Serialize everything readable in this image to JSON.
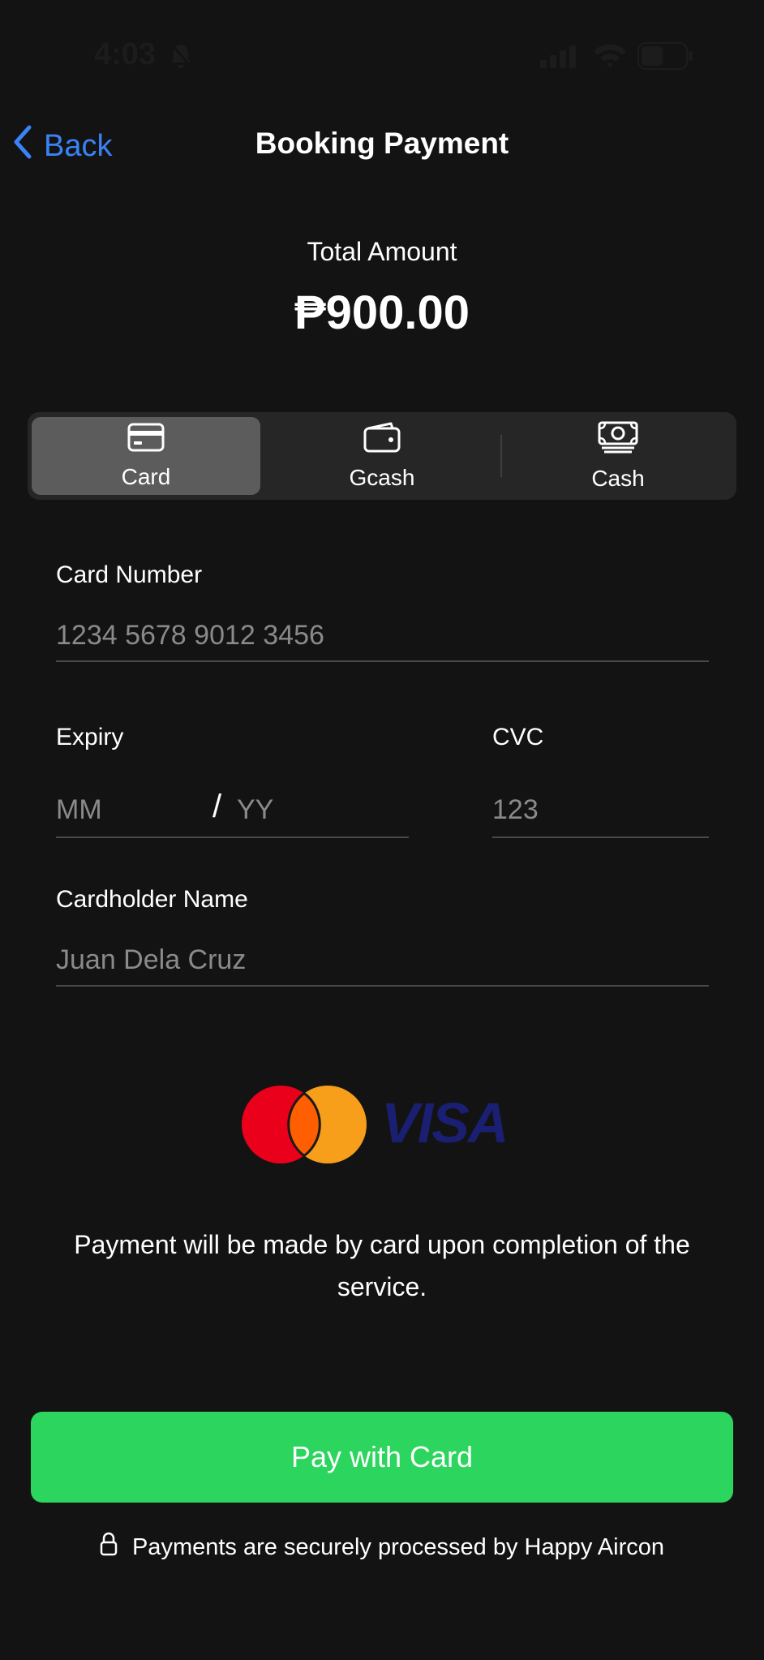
{
  "status_bar": {
    "time": "4:03"
  },
  "nav": {
    "back_label": "Back",
    "title": "Booking Payment"
  },
  "total": {
    "label": "Total Amount",
    "value": "₱900.00"
  },
  "payment_methods": [
    {
      "label": "Card",
      "icon": "credit-card-icon",
      "active": true
    },
    {
      "label": "Gcash",
      "icon": "wallet-icon",
      "active": false
    },
    {
      "label": "Cash",
      "icon": "banknote-icon",
      "active": false
    }
  ],
  "form": {
    "card_number": {
      "label": "Card Number",
      "placeholder": "1234 5678 9012 3456",
      "value": ""
    },
    "expiry": {
      "label": "Expiry",
      "month_placeholder": "MM",
      "separator": "/",
      "year_placeholder": "YY"
    },
    "cvc": {
      "label": "CVC",
      "placeholder": "123"
    },
    "cardholder": {
      "label": "Cardholder Name",
      "placeholder": "Juan Dela Cruz"
    }
  },
  "logos": {
    "visa_text": "VISA"
  },
  "info_text": "Payment will be made by card upon completion of the service.",
  "pay_button_label": "Pay with Card",
  "secure_text": "Payments are securely processed by Happy Aircon",
  "colors": {
    "background": "#131313",
    "accent_blue": "#3b82f6",
    "pay_green": "#2cd55d",
    "segment_active": "#5c5c5c",
    "mastercard_red": "#eb001b",
    "mastercard_orange": "#f79e1b",
    "visa_blue": "#1a1f71"
  }
}
